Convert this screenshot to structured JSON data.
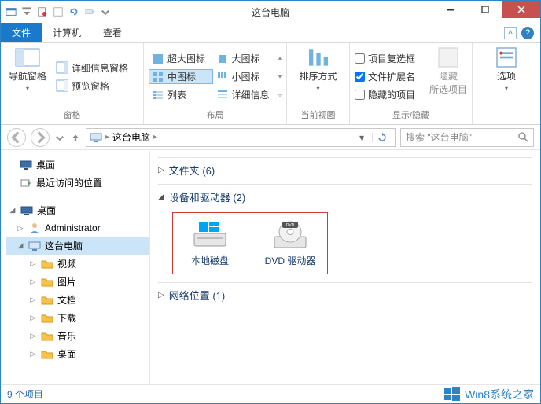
{
  "window": {
    "title": "这台电脑"
  },
  "tabs": {
    "file": "文件",
    "computer": "计算机",
    "view": "查看"
  },
  "ribbon": {
    "panes": {
      "nav_pane": "导航窗格",
      "preview_pane": "预览窗格",
      "details_pane": "详细信息窗格",
      "group_label": "窗格"
    },
    "layout": {
      "extra_large": "超大图标",
      "large": "大图标",
      "medium": "中图标",
      "small": "小图标",
      "list": "列表",
      "details": "详细信息",
      "group_label": "布局"
    },
    "current_view": {
      "sort_by": "排序方式",
      "group_label": "当前视图"
    },
    "show_hide": {
      "checkboxes": "项目复选框",
      "extensions": "文件扩展名",
      "hidden": "隐藏的项目",
      "hide_btn": "隐藏\n所选项目",
      "group_label": "显示/隐藏"
    },
    "options": {
      "label": "选项"
    }
  },
  "address": {
    "root": "这台电脑",
    "search_placeholder": "搜索 \"这台电脑\""
  },
  "tree": {
    "quick": {
      "desktop": "桌面",
      "recent": "最近访问的位置"
    },
    "desktop_root": "桌面",
    "admin": "Administrator",
    "this_pc": "这台电脑",
    "folders": {
      "videos": "视频",
      "pictures": "图片",
      "documents": "文档",
      "downloads": "下载",
      "music": "音乐",
      "desktop": "桌面"
    }
  },
  "content": {
    "folders_header": "文件夹 (6)",
    "devices_header": "设备和驱动器 (2)",
    "network_header": "网络位置 (1)",
    "drives": {
      "local": "本地磁盘",
      "dvd": "DVD 驱动器"
    }
  },
  "status": {
    "items": "9 个项目"
  },
  "brand": "Win8系统之家",
  "checked": {
    "extensions": true,
    "checkboxes": false,
    "hidden": false
  }
}
